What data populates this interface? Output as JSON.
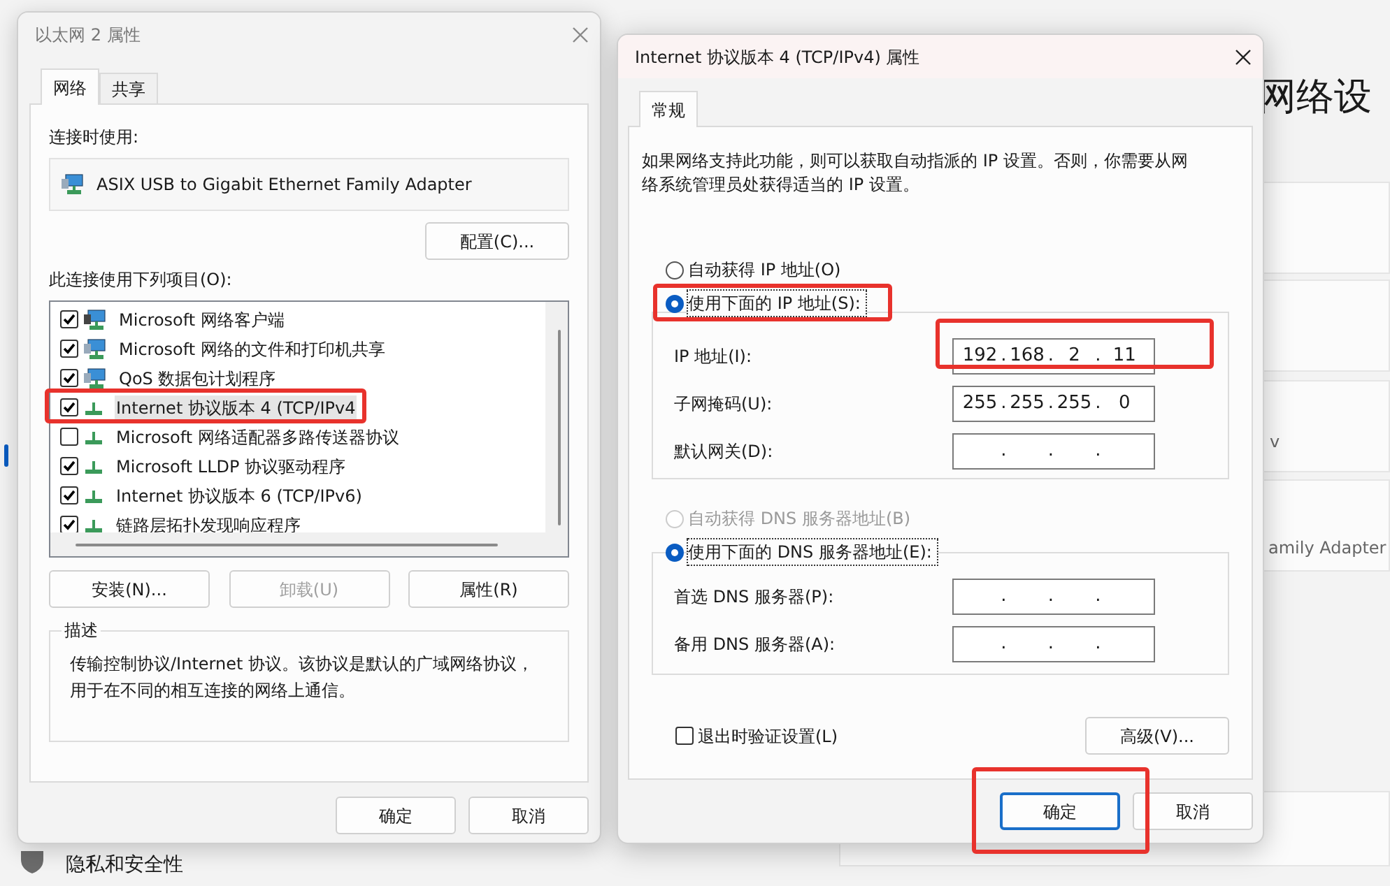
{
  "background": {
    "page_title": "网络设",
    "card_texts": [
      "v",
      "amily Adapter"
    ],
    "sidebar_item": "隐私和安全性"
  },
  "adapter_dialog": {
    "title": "以太网 2 属性",
    "tabs": [
      {
        "label": "网络",
        "selected": true
      },
      {
        "label": "共享",
        "selected": false
      }
    ],
    "connect_using_label": "连接时使用:",
    "adapter_name": "ASIX USB to Gigabit Ethernet Family Adapter",
    "configure_button": "配置(C)...",
    "items_label": "此连接使用下列项目(O):",
    "items": [
      {
        "label": "Microsoft 网络客户端",
        "checked": true,
        "selected": false,
        "kind": "client"
      },
      {
        "label": "Microsoft 网络的文件和打印机共享",
        "checked": true,
        "selected": false,
        "kind": "service"
      },
      {
        "label": "QoS 数据包计划程序",
        "checked": true,
        "selected": false,
        "kind": "service"
      },
      {
        "label": "Internet 协议版本 4 (TCP/IPv4",
        "checked": true,
        "selected": true,
        "kind": "protocol"
      },
      {
        "label": "Microsoft 网络适配器多路传送器协议",
        "checked": false,
        "selected": false,
        "kind": "protocol"
      },
      {
        "label": "Microsoft LLDP 协议驱动程序",
        "checked": true,
        "selected": false,
        "kind": "protocol"
      },
      {
        "label": "Internet 协议版本 6 (TCP/IPv6)",
        "checked": true,
        "selected": false,
        "kind": "protocol"
      },
      {
        "label": "链路层拓扑发现响应程序",
        "checked": true,
        "selected": false,
        "kind": "protocol"
      }
    ],
    "buttons": [
      {
        "label": "安装(N)...",
        "disabled": false
      },
      {
        "label": "卸载(U)",
        "disabled": true
      },
      {
        "label": "属性(R)",
        "disabled": false
      }
    ],
    "description_label": "描述",
    "description": "传输控制协议/Internet 协议。该协议是默认的广域网络协议，用于在不同的相互连接的网络上通信。",
    "footer_buttons": [
      {
        "label": "确定",
        "default": false
      },
      {
        "label": "取消",
        "default": false
      }
    ]
  },
  "ipv4_dialog": {
    "title": "Internet 协议版本 4 (TCP/IPv4) 属性",
    "tabs": [
      {
        "label": "常规",
        "selected": true
      }
    ],
    "intro": "如果网络支持此功能，则可以获取自动指派的 IP 设置。否则，你需要从网络系统管理员处获得适当的 IP 设置。",
    "separator": ".",
    "ip_options": [
      {
        "label": "自动获得 IP 地址(O)",
        "selected": false,
        "disabled": false
      },
      {
        "label": "使用下面的 IP 地址(S):",
        "selected": true,
        "disabled": false
      }
    ],
    "ip_fields": [
      {
        "label": "IP 地址(I):",
        "octets": [
          "192",
          "168",
          "2",
          "11"
        ]
      },
      {
        "label": "子网掩码(U):",
        "octets": [
          "255",
          "255",
          "255",
          "0"
        ]
      },
      {
        "label": "默认网关(D):"
      }
    ],
    "dns_options": [
      {
        "label": "自动获得 DNS 服务器地址(B)",
        "selected": false,
        "disabled": true
      },
      {
        "label": "使用下面的 DNS 服务器地址(E):",
        "selected": true,
        "disabled": false
      }
    ],
    "dns_fields": [
      {
        "label": "首选 DNS 服务器(P):"
      },
      {
        "label": "备用 DNS 服务器(A):"
      }
    ],
    "validate_on_exit": {
      "label": "退出时验证设置(L)",
      "checked": false
    },
    "advanced_button": "高级(V)...",
    "footer_buttons": [
      {
        "label": "确定",
        "default": true
      },
      {
        "label": "取消",
        "default": false
      }
    ]
  }
}
